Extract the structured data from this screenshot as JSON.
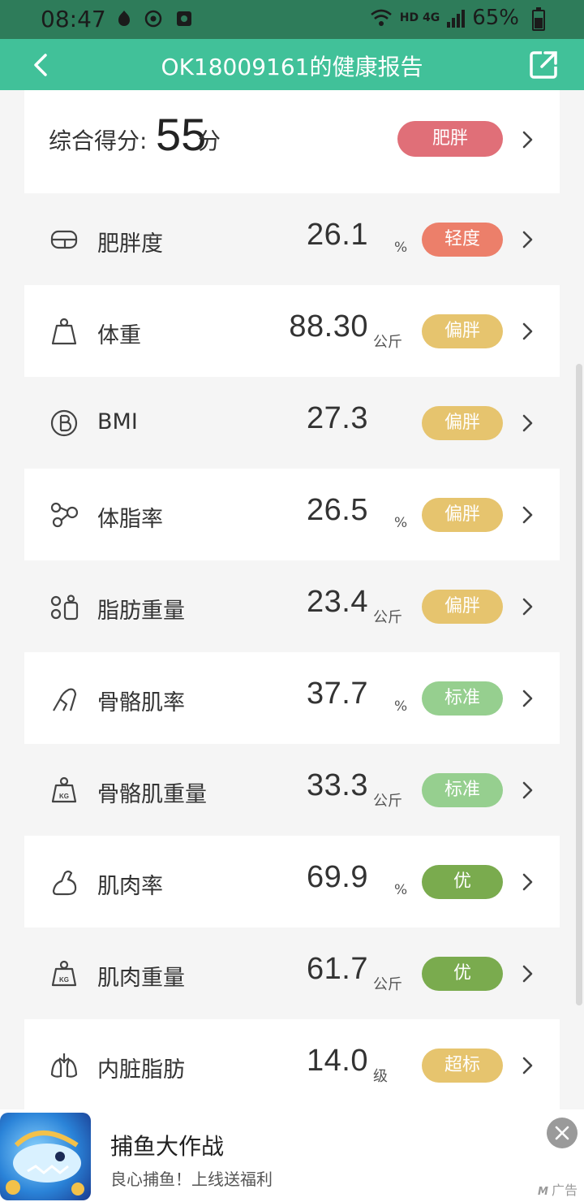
{
  "status_bar": {
    "time": "08:47",
    "network": "HD 4G",
    "battery": "65%"
  },
  "app_bar": {
    "title": "OK18009161的健康报告"
  },
  "score": {
    "label": "综合得分:",
    "value": "55",
    "unit": "分",
    "badge": "肥胖",
    "badge_color": "#e06f78"
  },
  "metrics": [
    {
      "name": "肥胖度",
      "value": "26.1",
      "unit": "%",
      "badge": "轻度",
      "badge_color": "#ec7f6a",
      "icon": "scale-icon"
    },
    {
      "name": "体重",
      "value": "88.30",
      "unit": "公斤",
      "badge": "偏胖",
      "badge_color": "#e6c46e",
      "icon": "weight-icon"
    },
    {
      "name": "BMI",
      "value": "27.3",
      "unit": "",
      "badge": "偏胖",
      "badge_color": "#e6c46e",
      "icon": "bmi-icon"
    },
    {
      "name": "体脂率",
      "value": "26.5",
      "unit": "%",
      "badge": "偏胖",
      "badge_color": "#e6c46e",
      "icon": "body-fat-rate-icon"
    },
    {
      "name": "脂肪重量",
      "value": "23.4",
      "unit": "公斤",
      "badge": "偏胖",
      "badge_color": "#e6c46e",
      "icon": "fat-weight-icon"
    },
    {
      "name": "骨骼肌率",
      "value": "37.7",
      "unit": "%",
      "badge": "标准",
      "badge_color": "#96cf8f",
      "icon": "muscle-leg-icon"
    },
    {
      "name": "骨骼肌重量",
      "value": "33.3",
      "unit": "公斤",
      "badge": "标准",
      "badge_color": "#96cf8f",
      "icon": "kg-weight-icon"
    },
    {
      "name": "肌肉率",
      "value": "69.9",
      "unit": "%",
      "badge": "优",
      "badge_color": "#7aab4e",
      "icon": "arm-muscle-icon"
    },
    {
      "name": "肌肉重量",
      "value": "61.7",
      "unit": "公斤",
      "badge": "优",
      "badge_color": "#7aab4e",
      "icon": "kg-weight-icon"
    },
    {
      "name": "内脏脂肪",
      "value": "14.0",
      "unit": "级",
      "badge": "超标",
      "badge_color": "#e6c46e",
      "icon": "lungs-icon"
    }
  ],
  "ad": {
    "title": "捕鱼大作战",
    "subtitle": "良心捕鱼！上线送福利",
    "tag": "广告"
  }
}
